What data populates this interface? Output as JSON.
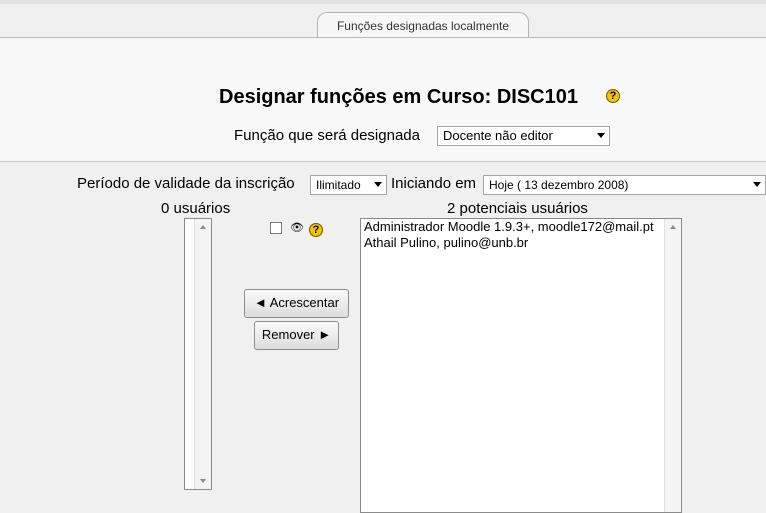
{
  "tabs": [
    {
      "label": "Funções designadas localmente"
    }
  ],
  "header": {
    "title": "Designar funções em Curso: DISC101",
    "help_glyph": "?"
  },
  "role": {
    "label": "Função que será designada",
    "selected": "Docente não editor"
  },
  "enrolment": {
    "period_label": "Período de validade da inscrição",
    "period_selected": "Ilimitado",
    "start_label": "Iniciando em",
    "start_selected": "Hoje ( 13 dezembro 2008)"
  },
  "current_users": {
    "count_label": "0 usuários",
    "items": []
  },
  "potential_users": {
    "count_label": "2 potenciais usuários",
    "items": [
      {
        "label": "Administrador Moodle 1.9.3+, moodle172@mail.pt"
      },
      {
        "label": "Athail Pulino, pulino@unb.br"
      }
    ]
  },
  "buttons": {
    "add": "◄ Acrescentar",
    "remove": "Remover ►"
  },
  "icons": {
    "eye": "👁",
    "help": "help-icon"
  },
  "colors": {
    "help_icon": "#f5c400",
    "page_bg": "#f0f0f0"
  }
}
